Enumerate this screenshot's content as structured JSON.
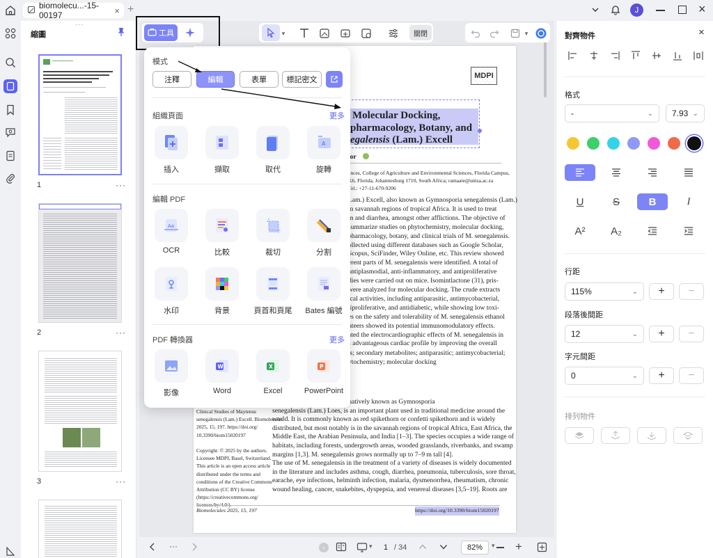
{
  "window": {
    "tab_title": "biomolecu...-15-00197",
    "avatar_initial": "J"
  },
  "thumbnails": {
    "title": "縮圖",
    "pages": [
      {
        "num": "1"
      },
      {
        "num": "2"
      },
      {
        "num": "3"
      }
    ],
    "more": "···"
  },
  "toolbar": {
    "tools_label": "工具",
    "close_label": "關閉"
  },
  "popup": {
    "mode_title": "模式",
    "modes": [
      "注釋",
      "編輯",
      "表單",
      "標記密文"
    ],
    "organize_title": "組織頁面",
    "organize_more": "更多",
    "organize_tools": [
      "插入",
      "擷取",
      "取代",
      "旋轉"
    ],
    "edit_title": "編輯 PDF",
    "edit_tools": [
      "OCR",
      "比較",
      "裁切",
      "分割",
      "水印",
      "背景",
      "頁首和頁尾",
      "Bates 編號"
    ],
    "convert_title": "PDF 轉換器",
    "convert_more": "更多",
    "convert_tools": [
      "影像",
      "Word",
      "Excel",
      "PowerPoint"
    ]
  },
  "document": {
    "logo": "MDPI",
    "title_lines": [
      "Molecular Docking,",
      "pharmacology, Botany, and"
    ],
    "title_line3_italic": "egalensis",
    "title_line3_rest": " (Lam.) Excell",
    "author_frag": "lor",
    "affil": [
      "ences, College of Agriculture and Environmental Sciences, Florida Campus,",
      "X6, Florida, Johannesburg 1710, South Africa; ramaate@unisa.ac.za",
      "Tel.: +27-11-670-9206"
    ],
    "abstract": [
      "Lam.) Excell, also known as Gymnosporia senegalensis (Lam.)",
      "in savannah regions of tropical Africa. It is used to treat",
      "m and diarrhea, amongst other afflictions. The objective of",
      "summarize studies on phytochemistry, molecular docking,",
      "pharmacology, botany, and clinical trials of M. senegalensis.",
      "ollected using different databases such as Google Scholar,",
      "Scopus, SciFinder, Wiley Online, etc. This review showed",
      "erent parts of M. senegalensis were identified. A total of",
      "antiplasmodial, anti-inflammatory, and antiproliferative",
      "dies were carried out on mice. Isomintlactone (31), pris-",
      "were analyzed for molecular docking. The crude extracts",
      "ical activities, including antiparasitic, antimycobacterial,",
      "tiproliferative, and antidiabetic, while showing low toxi-",
      "es on the safety and tolerability of M. senegalensis ethanol",
      "nteers showed its potential immunomodulatory effects.",
      "ated the electrocardiographic effects of M. senegalensis in",
      "s advantageous cardiac profile by improving the overall"
    ],
    "keywords": [
      "is; secondary metabolites; antiparasitic; antimycobacterial;",
      "ytochemistry; molecular docking"
    ],
    "sidebar_col": [
      "Clinical Studies of Maytenus",
      "senegalensis (Lam.) Excell. Biomolecules",
      "2025, 15, 197. https://doi.org/",
      "10.3390/biom15020197",
      "",
      "Copyright: © 2025 by the authors.",
      "Licensee MDPI, Basel, Switzerland.",
      "This article is an open access article",
      "distributed under the terms and",
      "conditions of the Creative Commons",
      "Attribution (CC BY) license",
      "(https://creativecommons.org/",
      "licenses/by/4.0/)."
    ],
    "body": [
      ") Excell (Celastraceae), alternatively known as Gymnosporia",
      "senegalensis (Lam.) Loes, is an important plant used in traditional medicine around the",
      "world.  It is commonly known as red spikethorn or confetti spikethorn and is widely",
      "distributed, but most notably is in the savannah regions of tropical Africa, East Africa, the",
      "Middle East, the Arabian Peninsula, and India [1–3]. The species occupies a wide range of",
      "habitats, including forests, undergrowth areas, wooded grasslands, riverbanks, and swamp",
      "margins [1,3]. M. senegalensis grows normally up to 7–9 m tall [4].",
      "     The use of M. senegalensis in the treatment of a variety of diseases is widely documented",
      "in the literature and includes asthma, cough, diarrhea, pneumonia, tuberculosis, sore throat,",
      "earache, eye infections, helminth infection, malaria, dysmenorrhea, rheumatism, chronic",
      "wound healing, cancer, snakebites, dyspepsia, and venereal diseases [3,5–19]. Roots are"
    ],
    "footer_left": "Biomolecules 2025, 15, 197",
    "footer_right": "https://doi.org/10.3390/biom15020197"
  },
  "rightpanel": {
    "title": "對齊物件",
    "format_title": "格式",
    "font_family": "-",
    "font_size": "7.93",
    "colors": [
      "#f6c633",
      "#3ccf6a",
      "#35d3e8",
      "#8e9af7",
      "#f05ad8",
      "#f06a4a",
      "#111111"
    ],
    "line_title": "行距",
    "line_value": "115%",
    "para_title": "段落後間距",
    "para_value": "12",
    "char_title": "字元間距",
    "char_value": "0",
    "arrange_title": "排列物件"
  },
  "bottombar": {
    "page_current": "1",
    "page_total": "/ 34",
    "zoom": "82%"
  }
}
